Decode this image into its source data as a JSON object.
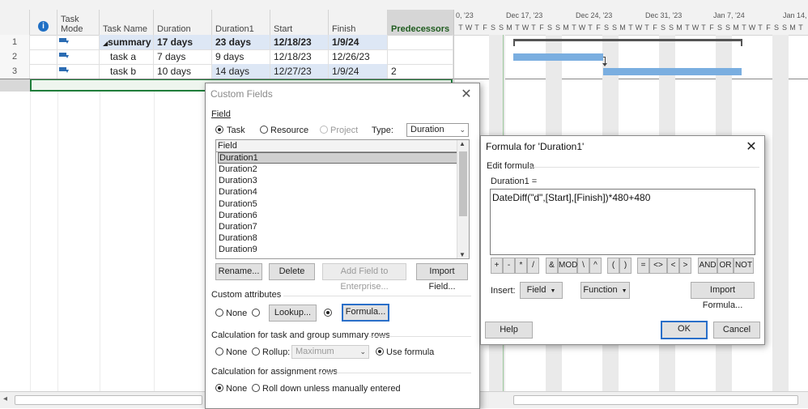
{
  "grid": {
    "headers": {
      "task_mode": "Task\nMode",
      "task_name": "Task Name",
      "duration": "Duration",
      "duration1": "Duration1",
      "start": "Start",
      "finish": "Finish",
      "predecessors": "Predecessors"
    },
    "rows": [
      {
        "id": "1",
        "name": "summary",
        "duration": "17 days",
        "duration1": "23 days",
        "start": "12/18/23",
        "finish": "1/9/24",
        "pred": ""
      },
      {
        "id": "2",
        "name": "task a",
        "duration": "7 days",
        "duration1": "9 days",
        "start": "12/18/23",
        "finish": "12/26/23",
        "pred": ""
      },
      {
        "id": "3",
        "name": "task b",
        "duration": "10 days",
        "duration1": "14 days",
        "start": "12/27/23",
        "finish": "1/9/24",
        "pred": "2"
      }
    ]
  },
  "gantt": {
    "weeks": [
      "0, '23",
      "Dec 17, '23",
      "Dec 24, '23",
      "Dec 31, '23",
      "Jan 7, '24",
      "Jan 14, '"
    ],
    "days": [
      "T",
      "W",
      "T",
      "F",
      "S",
      "S",
      "M",
      "T",
      "W",
      "T",
      "F",
      "S",
      "S",
      "M",
      "T",
      "W",
      "T",
      "F",
      "S",
      "S",
      "M",
      "T",
      "W",
      "T",
      "F",
      "S",
      "S",
      "M",
      "T",
      "W",
      "T",
      "F",
      "S",
      "S",
      "M",
      "T",
      "W",
      "T",
      "F",
      "S",
      "S",
      "M",
      "T"
    ]
  },
  "custom_fields": {
    "title": "Custom Fields",
    "field_label": "Field",
    "radio_task": "Task",
    "radio_resource": "Resource",
    "radio_project": "Project",
    "type_label": "Type:",
    "type_value": "Duration",
    "list_header": "Field",
    "list_items": [
      "Duration1",
      "Duration2",
      "Duration3",
      "Duration4",
      "Duration5",
      "Duration6",
      "Duration7",
      "Duration8",
      "Duration9"
    ],
    "btn_rename": "Rename...",
    "btn_delete": "Delete",
    "btn_add_enterprise": "Add Field to Enterprise...",
    "btn_import_field": "Import Field...",
    "custom_attributes_label": "Custom attributes",
    "attr_none": "None",
    "btn_lookup": "Lookup...",
    "btn_formula": "Formula...",
    "calc_summary_label": "Calculation for task and group summary rows",
    "calc_none": "None",
    "calc_rollup": "Rollup:",
    "rollup_value": "Maximum",
    "calc_use_formula": "Use formula",
    "calc_assign_label": "Calculation for assignment rows",
    "assign_none": "None",
    "assign_rolldown": "Roll down unless manually entered"
  },
  "formula_dialog": {
    "title": "Formula for 'Duration1'",
    "edit_formula_label": "Edit formula",
    "field_eq": "Duration1 =",
    "formula": "DateDiff(\"d\",[Start],[Finish])*480+480",
    "operators": [
      "+",
      "-",
      "*",
      "/",
      "&",
      "MOD",
      "\\",
      "^",
      "(",
      ")",
      "=",
      "<>",
      "<",
      ">",
      "AND",
      "OR",
      "NOT"
    ],
    "insert_label": "Insert:",
    "btn_field": "Field",
    "btn_function": "Function",
    "btn_import_formula": "Import Formula...",
    "btn_help": "Help",
    "btn_ok": "OK",
    "btn_cancel": "Cancel"
  }
}
